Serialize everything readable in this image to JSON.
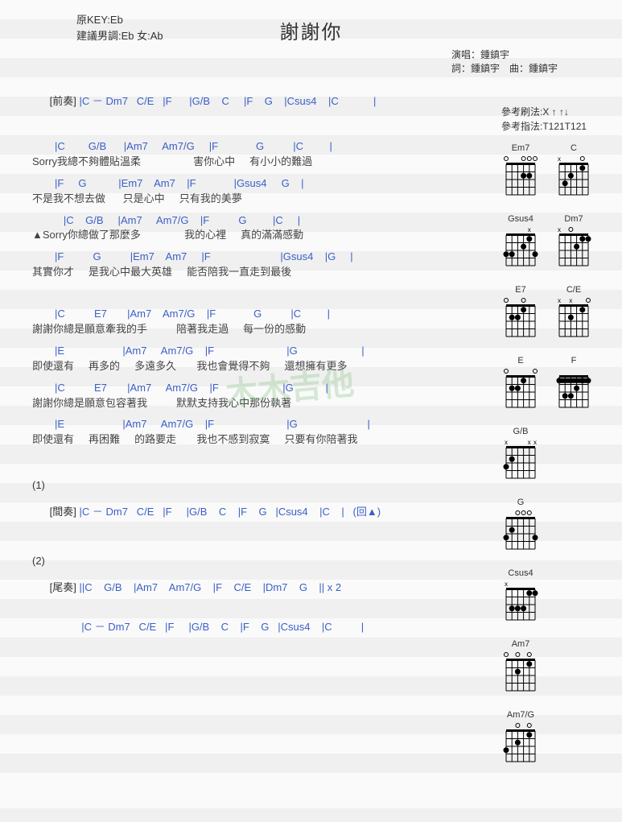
{
  "title": "謝謝你",
  "key_info": {
    "original": "原KEY:Eb",
    "suggest": "建議男調:Eb 女:Ab"
  },
  "credits": {
    "singer": "演唱：鍾鎮宇",
    "writer": "詞：鍾鎮宇　曲：鍾鎮宇"
  },
  "strum": {
    "strum": "參考刷法:X ↑ ↑↓",
    "finger": "參考指法:T121T121"
  },
  "intro": {
    "tag": "[前奏]",
    "chords": " |C － Dm7   C/E   |F      |G/B    C     |F    G    |Csus4    |C            |"
  },
  "verse1": {
    "c1": "     |C        G/B      |Am7     Am7/G     |F             G          |C         |",
    "l1": "Sorry我總不夠體貼溫柔                  害你心中     有小小的難過",
    "c2": "     |F     G           |Em7    Am7    |F             |Gsus4     G    |",
    "l2": "不是我不想去做      只是心中     只有我的美夢",
    "c3": "        |C    G/B     |Am7     Am7/G    |F          G         |C     |",
    "l3": "▲Sorry你總做了那麼多               我的心裡     真的滿滿感動",
    "c4": "     |F          G          |Em7    Am7     |F                        |Gsus4    |G     |",
    "l4": "其實你才     是我心中最大英雄     能否陪我一直走到最後"
  },
  "chorus": {
    "c1": "     |C          E7       |Am7    Am7/G    |F             G          |C         |",
    "l1": "謝謝你總是願意牽我的手          陪著我走過     每一份的感動",
    "c2": "     |E                    |Am7     Am7/G    |F                         |G                      |",
    "l2": "即使還有     再多的     多遠多久       我也會覺得不夠     還想擁有更多",
    "c3": "     |C          E7       |Am7     Am7/G    |F                      |G           |",
    "l3": "謝謝你總是願意包容著我          默默支持我心中那份執著",
    "c4": "     |E                    |Am7     Am7/G    |F                         |G                        |",
    "l4": "即使還有     再困難     的路要走       我也不感到寂寞     只要有你陪著我"
  },
  "section1": {
    "num": "(1)",
    "tag": "[間奏]",
    "chords": " |C － Dm7   C/E   |F     |G/B    C    |F    G   |Csus4    |C    |   (回▲)"
  },
  "section2": {
    "num": "(2)",
    "tag": "[尾奏]",
    "chords1": " ||C    G/B    |Am7    Am7/G    |F    C/E    |Dm7    G    || x 2",
    "chords2": " |C － Dm7   C/E   |F     |G/B    C    |F    G   |Csus4    |C          |"
  },
  "chart_data": {
    "type": "table",
    "description": "Guitar chord diagrams",
    "chords": [
      {
        "name": "Em7",
        "open": "O  OOO",
        "dots": [
          [
            2,
            2
          ],
          [
            2,
            3
          ]
        ]
      },
      {
        "name": "C",
        "open": "X   O O",
        "dots": [
          [
            1,
            2
          ],
          [
            2,
            4
          ],
          [
            3,
            5
          ]
        ]
      },
      {
        "name": "Gsus4",
        "open": "    X",
        "dots": [
          [
            1,
            2
          ],
          [
            2,
            3
          ],
          [
            3,
            1
          ],
          [
            3,
            5
          ],
          [
            3,
            6
          ]
        ]
      },
      {
        "name": "Dm7",
        "open": "X O",
        "dots": [
          [
            1,
            1
          ],
          [
            1,
            2
          ],
          [
            2,
            3
          ]
        ]
      },
      {
        "name": "E7",
        "open": "O  O  O",
        "dots": [
          [
            1,
            3
          ],
          [
            2,
            4
          ],
          [
            2,
            5
          ]
        ]
      },
      {
        "name": "C/E",
        "open": "X X  O O",
        "dots": [
          [
            1,
            2
          ],
          [
            2,
            4
          ]
        ]
      },
      {
        "name": "E",
        "open": "O    OO",
        "dots": [
          [
            1,
            3
          ],
          [
            2,
            4
          ],
          [
            2,
            5
          ]
        ]
      },
      {
        "name": "F",
        "open": "",
        "dots": [
          [
            1,
            1
          ],
          [
            1,
            2
          ],
          [
            1,
            6
          ],
          [
            2,
            3
          ],
          [
            3,
            4
          ],
          [
            3,
            5
          ]
        ],
        "barre": 1
      },
      {
        "name": "G/B",
        "open": "",
        "dots": [
          [
            2,
            5
          ],
          [
            3,
            6
          ]
        ],
        "mute": "X   XX"
      },
      {
        "name": "G",
        "open": "  OOO",
        "dots": [
          [
            2,
            5
          ],
          [
            3,
            1
          ],
          [
            3,
            6
          ]
        ]
      },
      {
        "name": "Csus4",
        "open": "X",
        "dots": [
          [
            1,
            1
          ],
          [
            1,
            2
          ],
          [
            3,
            3
          ],
          [
            3,
            4
          ],
          [
            3,
            5
          ]
        ]
      },
      {
        "name": "Am7",
        "open": "O O O O",
        "dots": [
          [
            1,
            2
          ],
          [
            2,
            4
          ]
        ]
      },
      {
        "name": "Am7/G",
        "open": "  O O O",
        "dots": [
          [
            1,
            2
          ],
          [
            2,
            4
          ],
          [
            3,
            6
          ]
        ]
      }
    ]
  }
}
